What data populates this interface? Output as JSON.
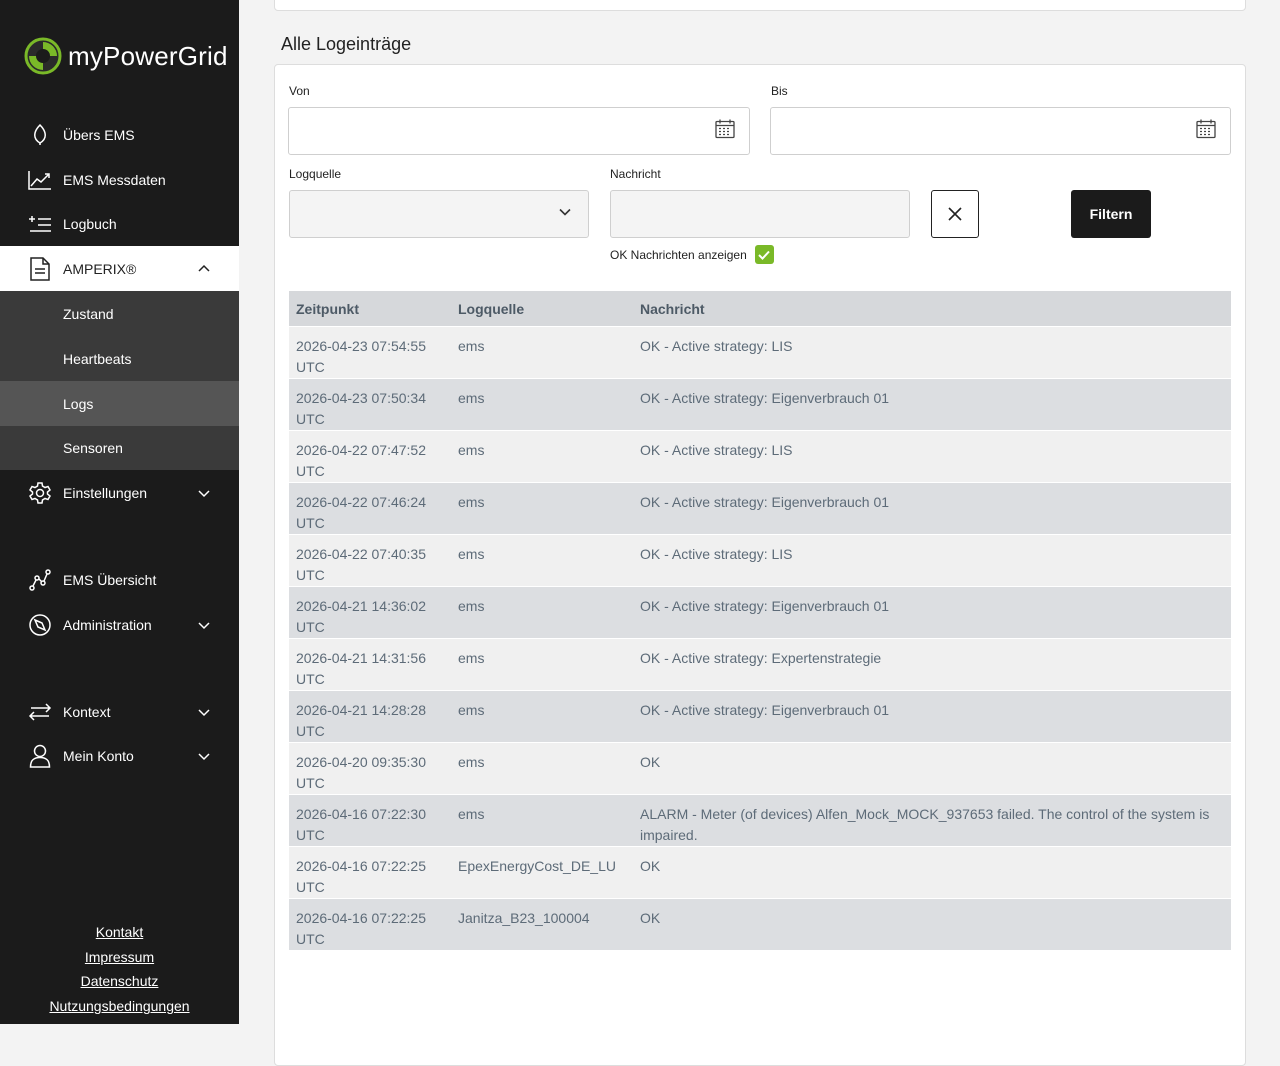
{
  "brand": {
    "name": "myPowerGrid"
  },
  "sidebar": {
    "items": [
      {
        "label": "Übers EMS",
        "icon": "leaf-icon"
      },
      {
        "label": "EMS Messdaten",
        "icon": "chart-line-icon"
      },
      {
        "label": "Logbuch",
        "icon": "list-add-icon"
      },
      {
        "label": "AMPERIX®",
        "icon": "document-icon"
      }
    ],
    "sub_items": [
      {
        "label": "Zustand"
      },
      {
        "label": "Heartbeats"
      },
      {
        "label": "Logs"
      },
      {
        "label": "Sensoren"
      }
    ],
    "items2": [
      {
        "label": "Einstellungen",
        "icon": "gear-icon"
      },
      {
        "label": "EMS Übersicht",
        "icon": "graph-nodes-icon"
      },
      {
        "label": "Administration",
        "icon": "compass-icon"
      },
      {
        "label": "Kontext",
        "icon": "swap-arrows-icon"
      },
      {
        "label": "Mein Konto",
        "icon": "user-icon"
      }
    ],
    "footer": [
      "Kontakt",
      "Impressum",
      "Datenschutz",
      "Nutzungsbedingungen"
    ]
  },
  "main": {
    "section_title": "Alle Logeinträge",
    "filters": {
      "from_label": "Von",
      "to_label": "Bis",
      "source_label": "Logquelle",
      "message_label": "Nachricht",
      "ok_label": "OK Nachrichten anzeigen",
      "ok_checked": true,
      "filter_button": "Filtern"
    },
    "table": {
      "headers": [
        "Zeitpunkt",
        "Logquelle",
        "Nachricht"
      ],
      "rows": [
        {
          "time": "2026-04-23 07:54:55",
          "tz": "UTC",
          "source": "ems",
          "message": "OK - Active strategy: LIS"
        },
        {
          "time": "2026-04-23 07:50:34",
          "tz": "UTC",
          "source": "ems",
          "message": "OK - Active strategy: Eigenverbrauch 01"
        },
        {
          "time": "2026-04-22 07:47:52",
          "tz": "UTC",
          "source": "ems",
          "message": "OK - Active strategy: LIS"
        },
        {
          "time": "2026-04-22 07:46:24",
          "tz": "UTC",
          "source": "ems",
          "message": "OK - Active strategy: Eigenverbrauch 01"
        },
        {
          "time": "2026-04-22 07:40:35",
          "tz": "UTC",
          "source": "ems",
          "message": "OK - Active strategy: LIS"
        },
        {
          "time": "2026-04-21 14:36:02",
          "tz": "UTC",
          "source": "ems",
          "message": "OK - Active strategy: Eigenverbrauch 01"
        },
        {
          "time": "2026-04-21 14:31:56",
          "tz": "UTC",
          "source": "ems",
          "message": "OK - Active strategy: Expertenstrategie"
        },
        {
          "time": "2026-04-21 14:28:28",
          "tz": "UTC",
          "source": "ems",
          "message": "OK - Active strategy: Eigenverbrauch 01"
        },
        {
          "time": "2026-04-20 09:35:30",
          "tz": "UTC",
          "source": "ems",
          "message": "OK"
        },
        {
          "time": "2026-04-16 07:22:30",
          "tz": "UTC",
          "source": "ems",
          "message": "ALARM - Meter (of devices) Alfen_Mock_MOCK_937653 failed. The control of the system is impaired."
        },
        {
          "time": "2026-04-16 07:22:25",
          "tz": "UTC",
          "source": "EpexEnergyCost_DE_LU",
          "message": "OK"
        },
        {
          "time": "2026-04-16 07:22:25",
          "tz": "UTC",
          "source": "Janitza_B23_100004",
          "message": "OK"
        }
      ]
    }
  },
  "colors": {
    "sidebar_bg": "#1b1b1b",
    "accent_green": "#7ab928",
    "submenu_bg": "#3a3a3a"
  }
}
